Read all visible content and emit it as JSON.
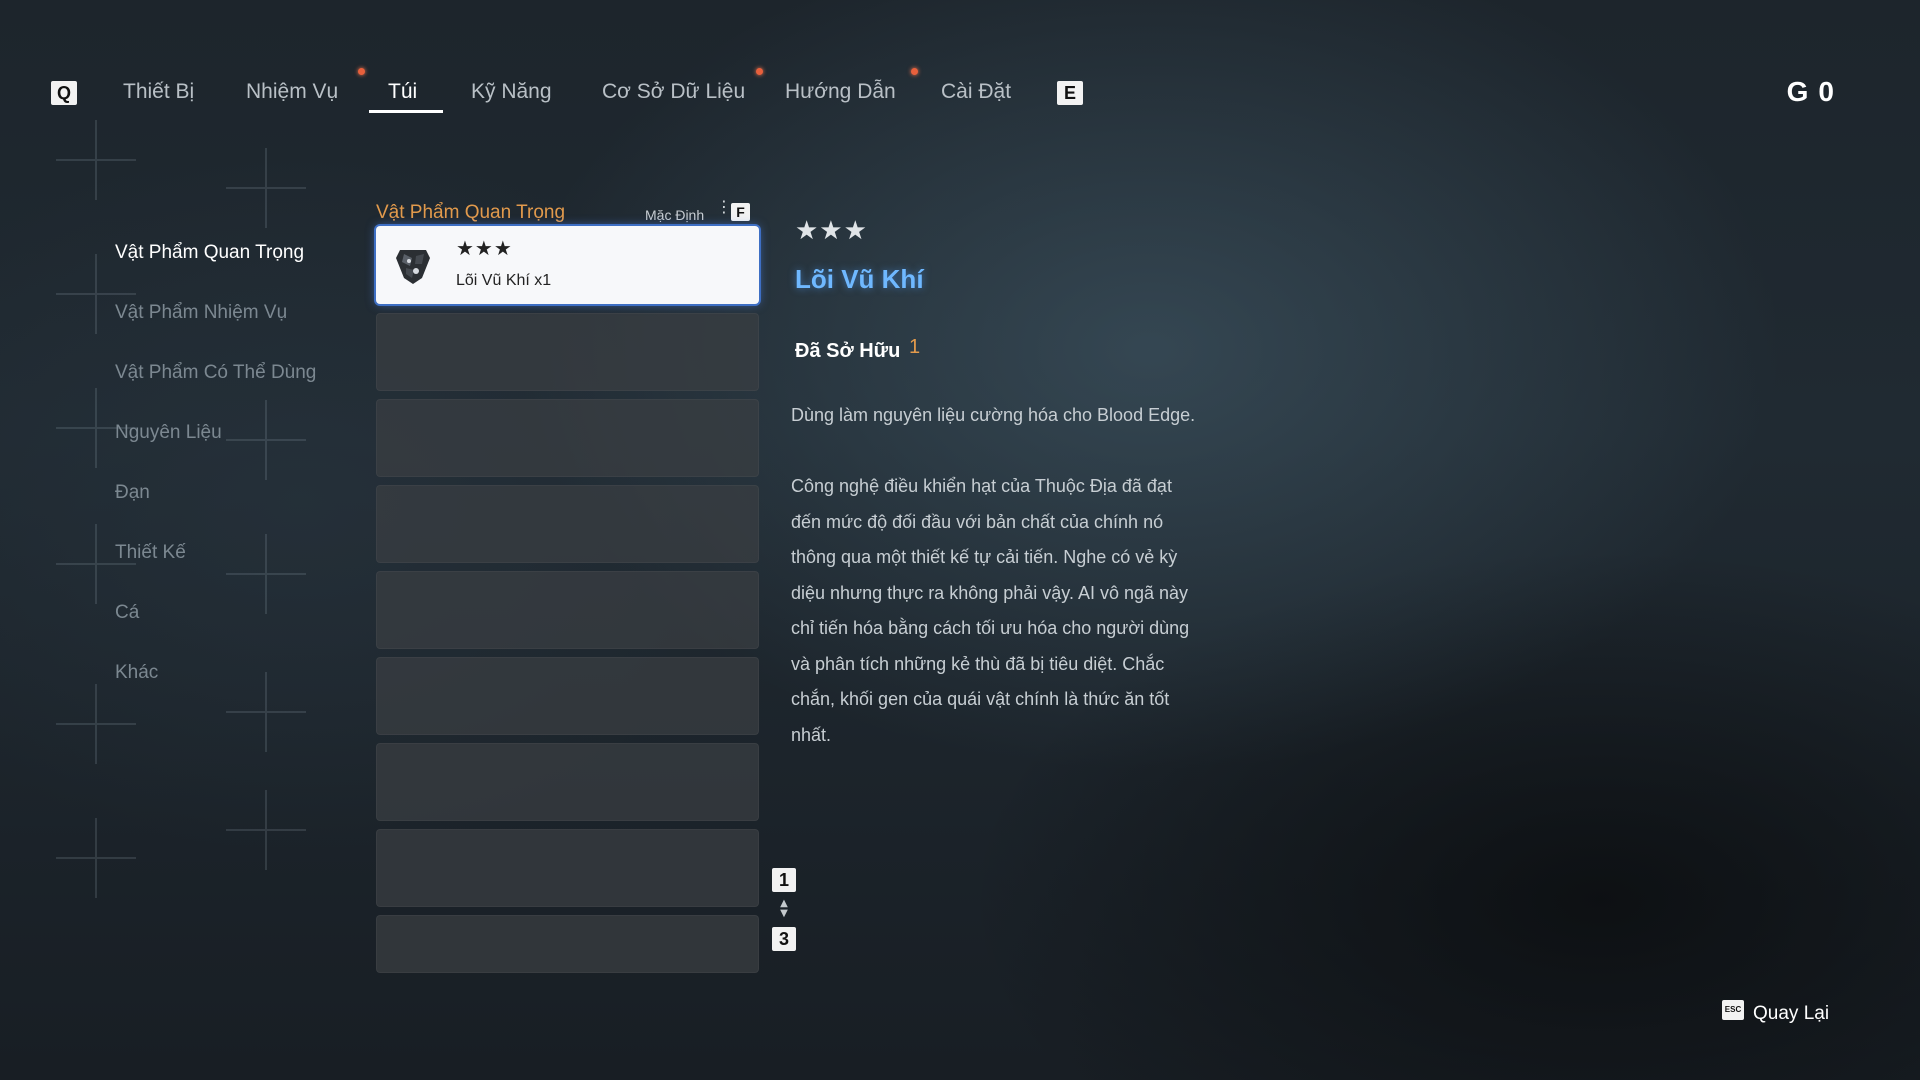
{
  "nav": {
    "prev_key": "Q",
    "next_key": "E",
    "tabs": [
      {
        "label": "Thiết Bị"
      },
      {
        "label": "Nhiệm Vụ"
      },
      {
        "label": "Túi"
      },
      {
        "label": "Kỹ Năng"
      },
      {
        "label": "Cơ Sở Dữ Liệu"
      },
      {
        "label": "Hướng Dẫn"
      },
      {
        "label": "Cài Đặt"
      }
    ],
    "active_tab": "Túi",
    "notification_color": "#e8603c"
  },
  "currency": {
    "symbol": "G",
    "amount": "0"
  },
  "categories": [
    {
      "label": "Vật Phẩm Quan Trọng"
    },
    {
      "label": "Vật Phẩm Nhiệm Vụ"
    },
    {
      "label": "Vật Phẩm Có Thể Dùng"
    },
    {
      "label": "Nguyên Liệu"
    },
    {
      "label": "Đạn"
    },
    {
      "label": "Thiết Kế"
    },
    {
      "label": "Cá"
    },
    {
      "label": "Khác"
    }
  ],
  "list": {
    "title": "Vật Phẩm Quan Trọng",
    "sort_label": "Mặc Định",
    "sort_key": "F",
    "items": [
      {
        "stars": "★★★",
        "name": "Lõi Vũ Khí x1",
        "icon": "weapon-core-icon"
      }
    ],
    "page_current": "1",
    "page_total": "3"
  },
  "detail": {
    "stars": "★★★",
    "name": "Lõi Vũ Khí",
    "owned_label": "Đã Sở Hữu",
    "owned_count": "1",
    "desc_lines_1": [
      "Dùng làm nguyên liệu cường hóa cho Blood Edge."
    ],
    "desc_lines_2": [
      "Công nghệ điều khiển hạt của Thuộc Địa đã đạt",
      "đến mức độ đối đầu với bản chất của chính nó",
      "thông qua một thiết kế tự cải tiến. Nghe có vẻ kỳ",
      "diệu nhưng thực ra không phải vậy. AI vô ngã này",
      "chỉ tiến hóa bằng cách tối ưu hóa cho người dùng",
      "và phân tích những kẻ thù đã bị tiêu diệt. Chắc",
      "chắn, khối gen của quái vật chính là thức ăn tốt",
      "nhất."
    ],
    "name_color": "#6fb8ff",
    "accent_color": "#e29a4c"
  },
  "footer": {
    "back_key": "ESC",
    "back_label": "Quay Lại"
  }
}
